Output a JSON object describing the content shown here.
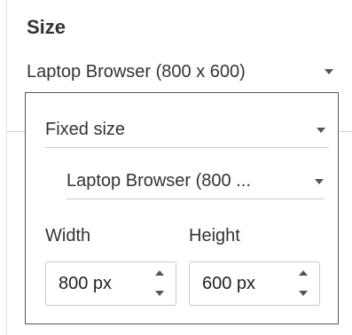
{
  "section": {
    "title": "Size"
  },
  "size_selector": {
    "value": "Laptop Browser (800 x 600)",
    "icon": "chevron-down-icon"
  },
  "popup": {
    "sizing_mode": {
      "value": "Fixed size",
      "icon": "chevron-down-icon"
    },
    "preset": {
      "value": "Laptop Browser (800 ...",
      "icon": "chevron-down-icon"
    },
    "width": {
      "label": "Width",
      "value": "800 px"
    },
    "height": {
      "label": "Height",
      "value": "600 px"
    }
  },
  "colors": {
    "text": "#333333",
    "popup_border": "#555555",
    "divider": "#c8c8c8"
  }
}
